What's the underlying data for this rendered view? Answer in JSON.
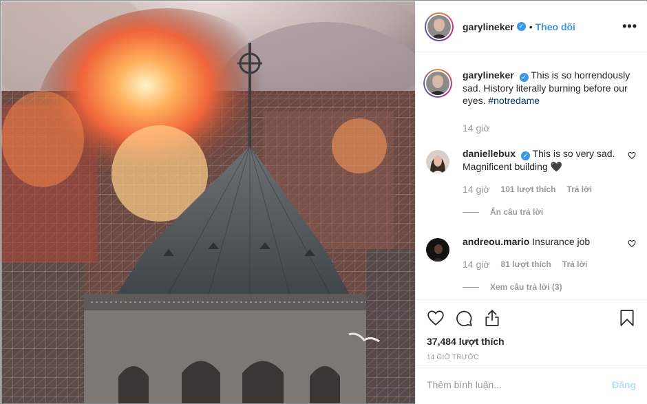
{
  "post": {
    "image_alt": "",
    "author": "garylineker",
    "verified": true,
    "follow_label": "Theo dõi",
    "separator": "•",
    "more_label": "•••"
  },
  "caption": {
    "username": "garylineker",
    "text": "This is so horrendously sad. History literally burning before our eyes.",
    "hashtag": "#notredame",
    "time": "14 giờ"
  },
  "comments": [
    {
      "username": "daniellebux",
      "verified": true,
      "text": "This is so very sad. Magnificent building",
      "emoji": "🖤",
      "time": "14 giờ",
      "likes": "101 lượt thích",
      "reply_label": "Trả lời",
      "thread_label": "Ẩn câu trả lời"
    },
    {
      "username": "andreou.mario",
      "verified": false,
      "text": "Insurance job",
      "time": "14 giờ",
      "likes": "81 lượt thích",
      "reply_label": "Trả lời",
      "thread_label": "Xem câu trả lời (3)"
    }
  ],
  "stats": {
    "likes": "37,484 lượt thích",
    "posted": "14 GIỜ TRƯỚC"
  },
  "composer": {
    "placeholder": "Thêm bình luận...",
    "post_label": "Đăng"
  },
  "icons": {
    "like": "heart-icon",
    "comment": "comment-icon",
    "share": "share-icon",
    "save": "bookmark-icon",
    "verified": "verified-badge-icon"
  },
  "colors": {
    "accent": "#3897f0",
    "muted": "#999999",
    "post_disabled": "#b2dffc",
    "divider": "#efefef"
  }
}
